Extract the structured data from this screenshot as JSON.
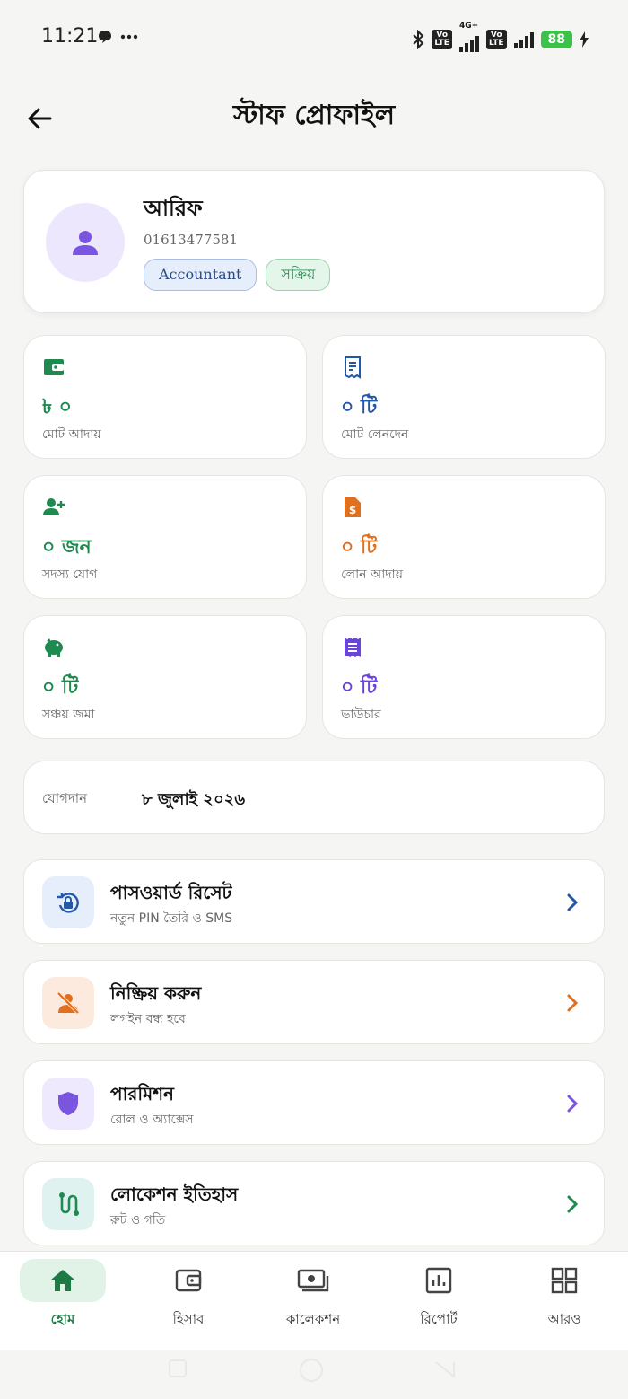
{
  "status_bar": {
    "time": "11:21",
    "network": "4G+",
    "volte": "Vo\nLTE",
    "battery": "88"
  },
  "header": {
    "title": "স্টাফ প্রোফাইল"
  },
  "profile": {
    "name": "আরিফ",
    "phone": "01613477581",
    "role": "Accountant",
    "status": "সক্রিয়"
  },
  "stats": [
    {
      "value": "৳ ০",
      "label": "মোট আদায়",
      "color": "#1e8a50",
      "icon": "wallet-icon"
    },
    {
      "value": "০ টি",
      "label": "মোট লেনদেন",
      "color": "#2557a7",
      "icon": "receipt-icon"
    },
    {
      "value": "০ জন",
      "label": "সদস্য যোগ",
      "color": "#1e8a50",
      "icon": "add-person-icon"
    },
    {
      "value": "০ টি",
      "label": "লোন আদায়",
      "color": "#e0701e",
      "icon": "loan-document-icon"
    },
    {
      "value": "০ টি",
      "label": "সঞ্চয় জমা",
      "color": "#1e8a50",
      "icon": "piggy-bank-icon"
    },
    {
      "value": "০ টি",
      "label": "ভাউচার",
      "color": "#6b45d8",
      "icon": "voucher-icon"
    }
  ],
  "joined": {
    "label": "যোগদান",
    "date": "৮ জুলাই ২০২৬"
  },
  "actions": [
    {
      "title": "পাসওয়ার্ড রিসেট",
      "subtitle": "নতুন PIN তৈরি ও SMS",
      "accent": "#2557a7",
      "bg": "#e5eefa",
      "icon": "lock-reset-icon"
    },
    {
      "title": "নিষ্ক্রিয় করুন",
      "subtitle": "লগইন বন্ধ হবে",
      "accent": "#e0701e",
      "bg": "#fdeadf",
      "icon": "person-off-icon"
    },
    {
      "title": "পারমিশন",
      "subtitle": "রোল ও অ্যাক্সেস",
      "accent": "#7a55e0",
      "bg": "#efe9fd",
      "icon": "shield-icon"
    },
    {
      "title": "লোকেশন ইতিহাস",
      "subtitle": "রুট ও গতি",
      "accent": "#1e8a50",
      "bg": "#dff2f0",
      "icon": "route-icon"
    }
  ],
  "nav": [
    {
      "label": "হোম",
      "icon": "home-icon",
      "active": true
    },
    {
      "label": "হিসাব",
      "icon": "wallet-icon",
      "active": false
    },
    {
      "label": "কালেকশন",
      "icon": "payments-icon",
      "active": false
    },
    {
      "label": "রিপোর্ট",
      "icon": "chart-icon",
      "active": false
    },
    {
      "label": "আরও",
      "icon": "grid-icon",
      "active": false
    }
  ]
}
